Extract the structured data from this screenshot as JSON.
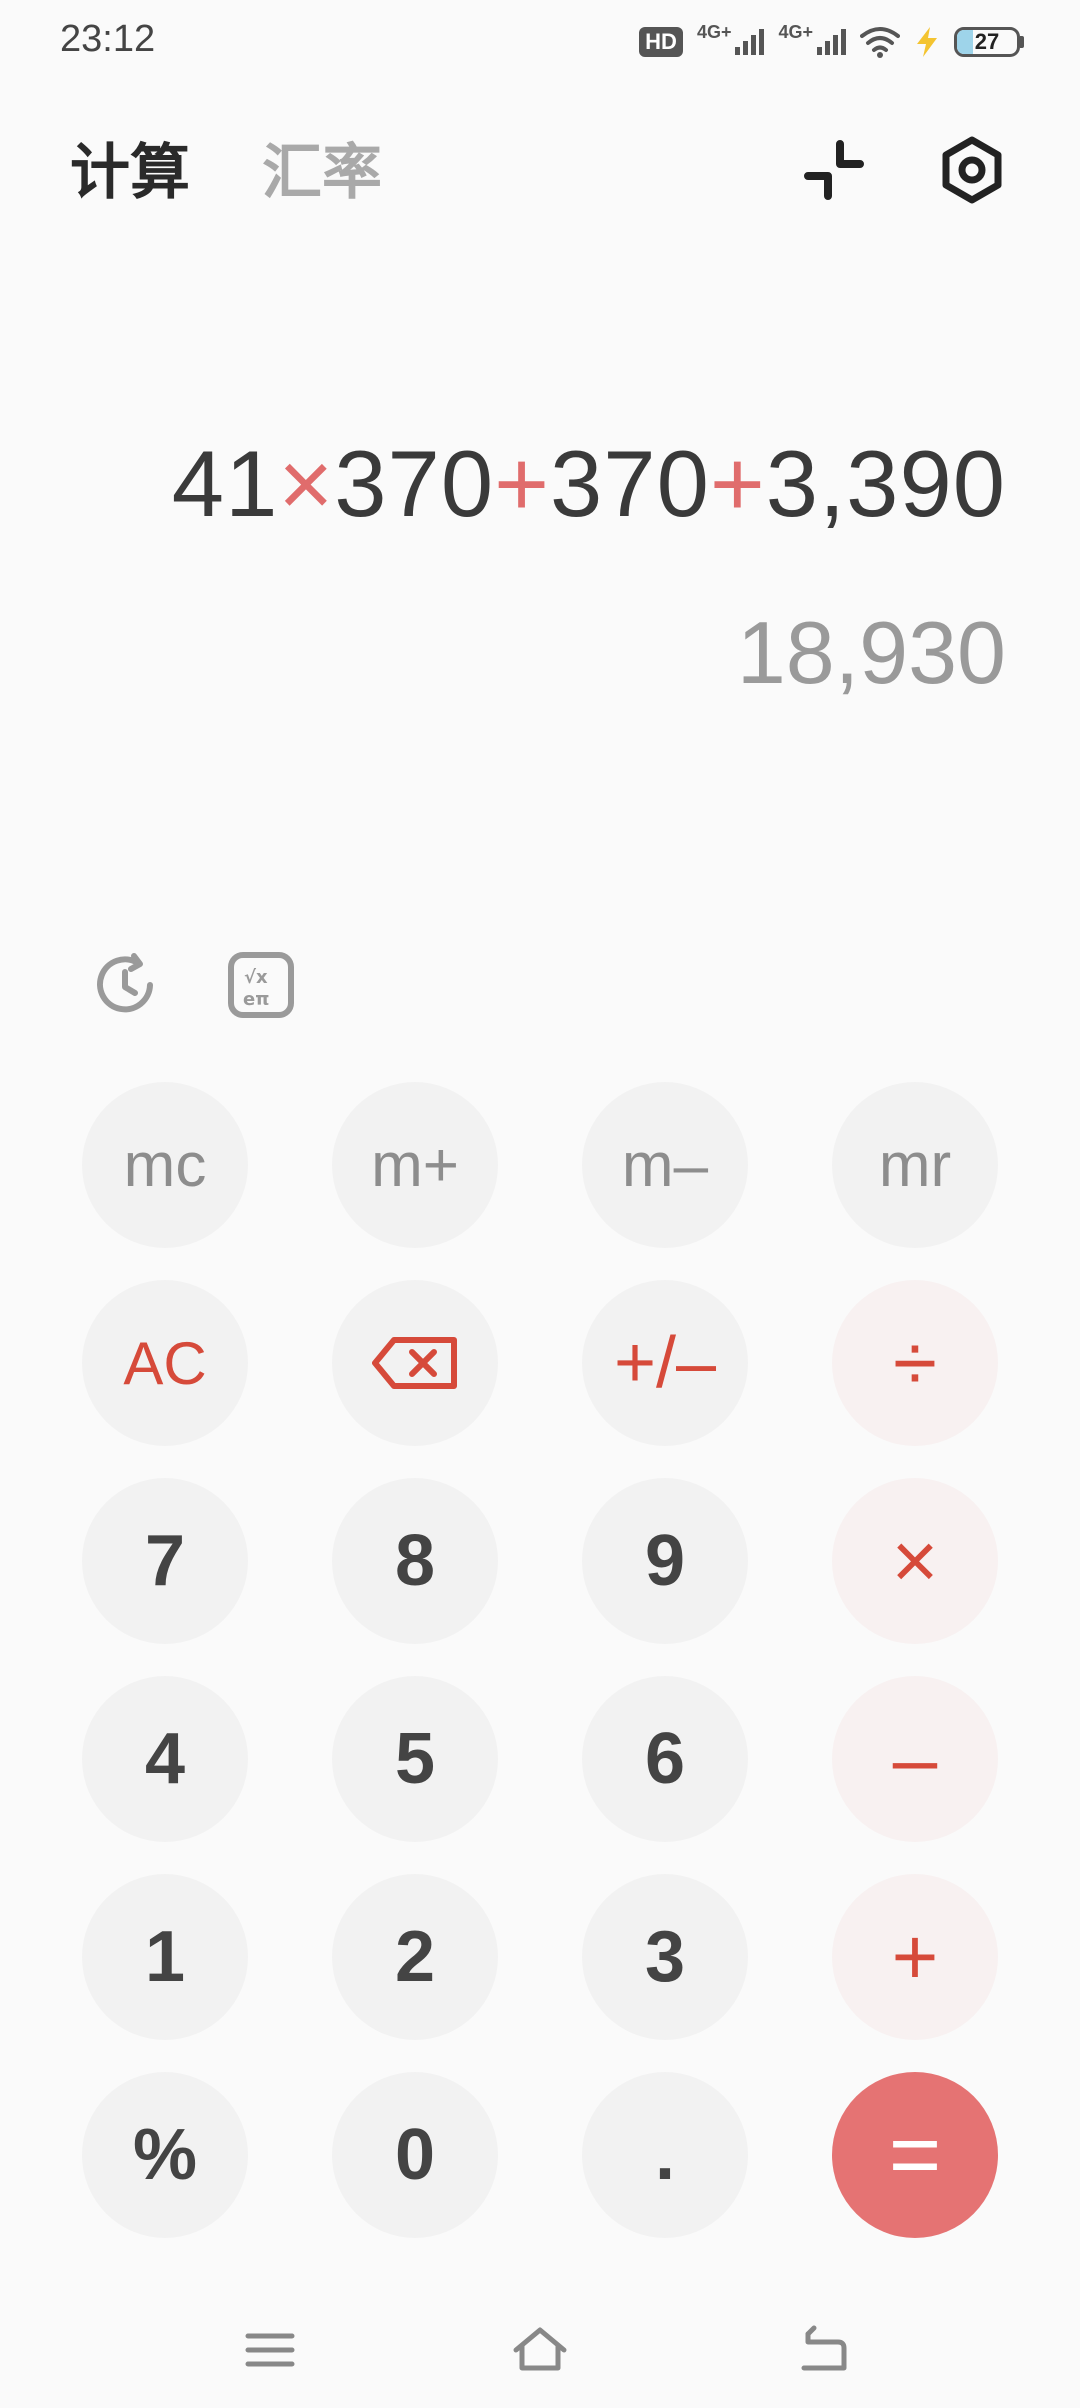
{
  "status_bar": {
    "time": "23:12",
    "hd_label": "HD",
    "sim1_label": "4G+",
    "sim2_label": "4G+",
    "battery_level": 27,
    "battery_text": "27"
  },
  "tabs": [
    {
      "label": "计算",
      "active": true
    },
    {
      "label": "汇率",
      "active": false
    }
  ],
  "display": {
    "expression_parts": [
      {
        "text": "41",
        "op": false
      },
      {
        "text": "×",
        "op": true
      },
      {
        "text": "370",
        "op": false
      },
      {
        "text": "+",
        "op": true
      },
      {
        "text": "370",
        "op": false
      },
      {
        "text": "+",
        "op": true
      },
      {
        "text": "3,390",
        "op": false
      }
    ],
    "result": "18,930"
  },
  "keys": {
    "mc": "mc",
    "mplus": "m+",
    "mminus": "m–",
    "mr": "mr",
    "ac": "AC",
    "plusminus": "+/–",
    "divide": "÷",
    "seven": "7",
    "eight": "8",
    "nine": "9",
    "multiply": "×",
    "four": "4",
    "five": "5",
    "six": "6",
    "minus": "–",
    "one": "1",
    "two": "2",
    "three": "3",
    "plus": "+",
    "percent": "%",
    "zero": "0",
    "dot": ".",
    "equals": "="
  },
  "colors": {
    "accent": "#e57373",
    "operator": "#d64a3a",
    "key_bg": "#f2f2f2",
    "background": "#fafafa"
  },
  "icons": {
    "collapse": "collapse-icon",
    "settings": "settings-icon",
    "history": "history-icon",
    "scientific": "scientific-icon",
    "backspace": "backspace-icon"
  }
}
